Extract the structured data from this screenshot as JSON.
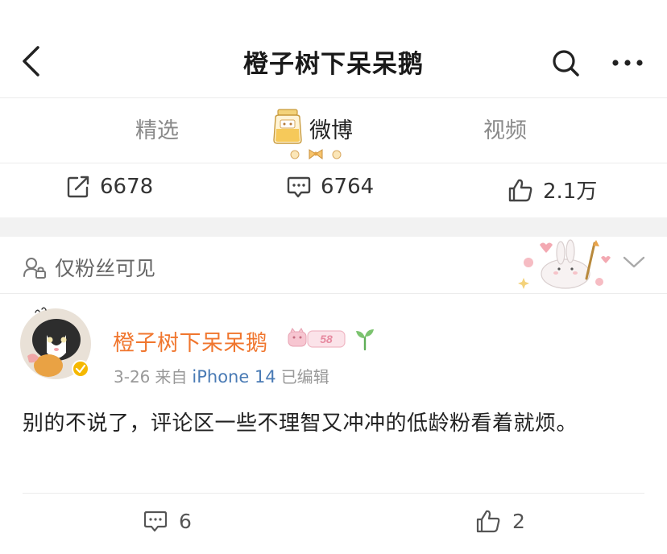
{
  "header": {
    "title": "橙子树下呆呆鹅",
    "back_icon": "chevron-left-icon",
    "search_icon": "search-icon",
    "more_icon": "more-dots-icon"
  },
  "tabs": [
    {
      "label": "精选",
      "active": false
    },
    {
      "label": "微博",
      "active": true
    },
    {
      "label": "视频",
      "active": false
    }
  ],
  "stats": {
    "reposts": "6678",
    "comments": "6764",
    "likes": "2.1万"
  },
  "visibility": {
    "label": "仅粉丝可见",
    "icon": "lock-people-icon"
  },
  "post": {
    "username": "橙子树下呆呆鹅",
    "level": "58",
    "date": "3-26",
    "source_prefix": "来自",
    "device": "iPhone 14",
    "edited": "已编辑",
    "text": "别的不说了，评论区一些不理智又冲冲的低龄粉看着就烦。",
    "comment_count": "6",
    "like_count": "2"
  },
  "colors": {
    "username": "#f0762e",
    "device": "#4a7bb5",
    "badge_pink": "#f4b6c4",
    "sprout_green": "#5fae57",
    "verified_yellow": "#f5b800"
  }
}
